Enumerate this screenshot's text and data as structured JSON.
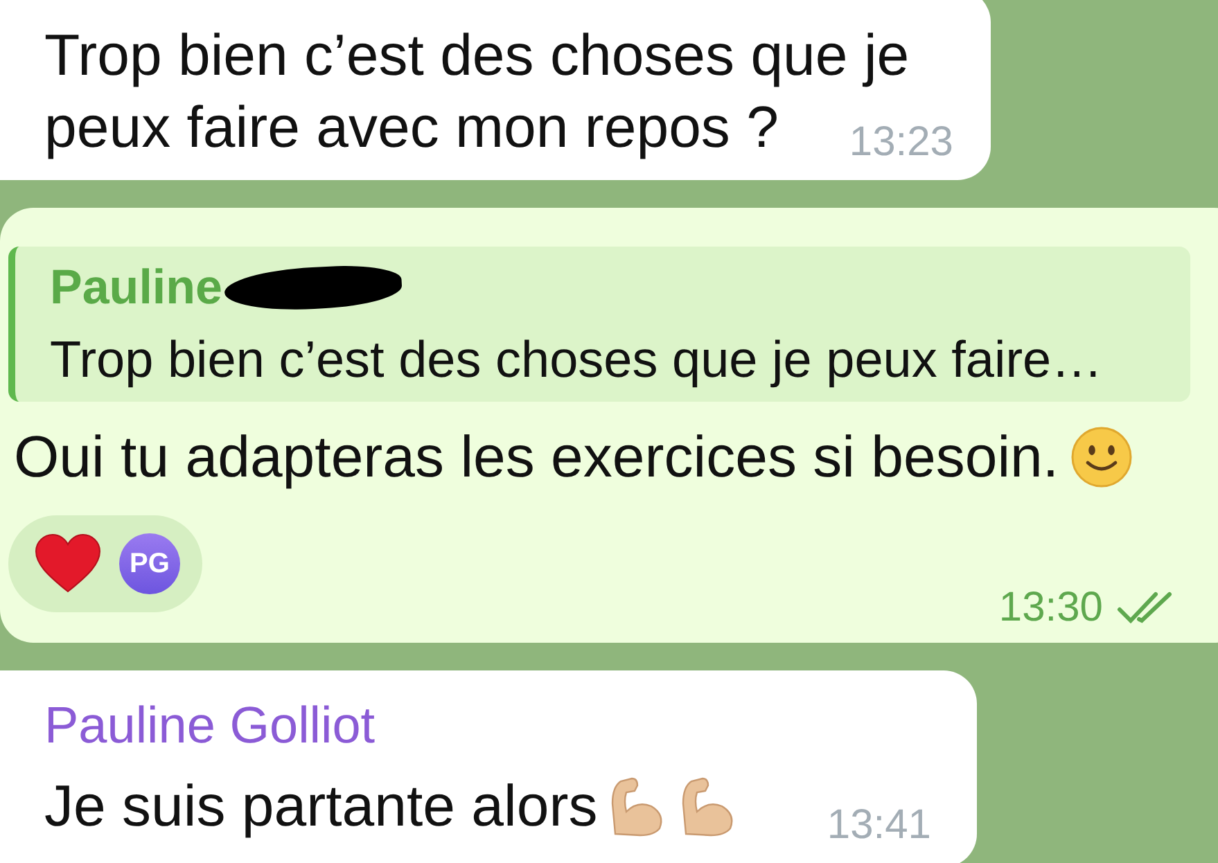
{
  "messages": [
    {
      "kind": "incoming",
      "lines": [
        "Trop bien c’est des choses que je",
        "peux faire avec mon repos ?"
      ],
      "time": "13:23"
    },
    {
      "kind": "outgoing",
      "reply": {
        "author": "Pauline",
        "redacted": true,
        "text": "Trop bien c’est des choses que je peux faire…"
      },
      "lines": [
        "Oui tu adapteras les exercices si besoin."
      ],
      "icons": [
        {
          "kind": "smiley"
        }
      ],
      "reactions": [
        {
          "kind": "heart"
        },
        {
          "kind": "avatar",
          "initials": "PG"
        }
      ],
      "time": "13:30",
      "read": true
    },
    {
      "kind": "incoming",
      "author": "Pauline Golliot",
      "lines": [
        "Je suis partante alors"
      ],
      "icons": [
        {
          "kind": "biceps"
        },
        {
          "kind": "biceps"
        }
      ],
      "time": "13:41"
    }
  ]
}
